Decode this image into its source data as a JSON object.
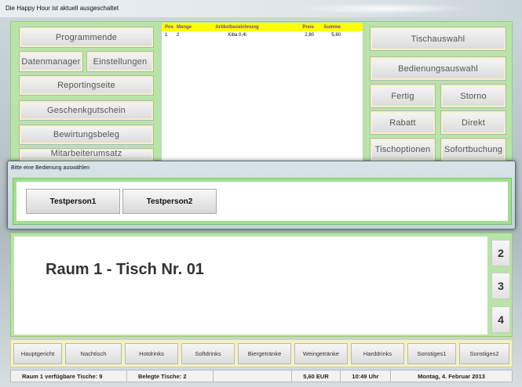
{
  "window": {
    "title": "Die Happy Hour ist aktuell ausgeschaltet"
  },
  "left_menu": {
    "programmende": "Programmende",
    "datenmanager": "Datenmanager",
    "einstellungen": "Einstellungen",
    "reporting": "Reportingseite",
    "geschenk": "Geschenkgutschein",
    "bewirtung": "Bewirtungsbeleg",
    "mitarbeiter": "Mitarbeiterumsatz"
  },
  "order": {
    "headers": {
      "pos": "Pos",
      "menge": "Menge",
      "artikel": "Artikelbezeichnung",
      "preis": "Preis",
      "summe": "Summe"
    },
    "rows": [
      {
        "pos": "1",
        "menge": "2",
        "artikel": "Kiba 0,4l",
        "preis": "2,80",
        "summe": "5,60"
      }
    ]
  },
  "right_menu": {
    "tischauswahl": "Tischauswahl",
    "bedienungsauswahl": "Bedienungsauswahl",
    "fertig": "Fertig",
    "storno": "Storno",
    "rabatt": "Rabatt",
    "direkt": "Direkt",
    "tischoptionen": "Tischoptionen",
    "sofortbuchung": "Sofortbuchung"
  },
  "dialog": {
    "title": "Bitte eine Bedienung auswählen",
    "persons": [
      "Testperson1",
      "Testperson2"
    ]
  },
  "table": {
    "label": "Raum 1 - Tisch Nr. 01",
    "side_numbers": [
      "2",
      "3",
      "4"
    ]
  },
  "categories": [
    "Hauptgericht",
    "Nachtisch",
    "Hotdrinks",
    "Softdrinks",
    "Biergetränke",
    "Weingetränke",
    "Harddrinks",
    "Sonstiges1",
    "Sonstiges2"
  ],
  "status": {
    "free_tables": "Raum 1 verfügbare Tische: 9",
    "occupied": "Belegte Tische: 2",
    "amount": "5,60 EUR",
    "time": "10:49 Uhr",
    "date": "Montag, 4. Februar 2013"
  },
  "colors": {
    "frame_green": "#b9e4a8",
    "panel_yellow": "#f2f2c4",
    "header_yellow": "#ffff00"
  }
}
